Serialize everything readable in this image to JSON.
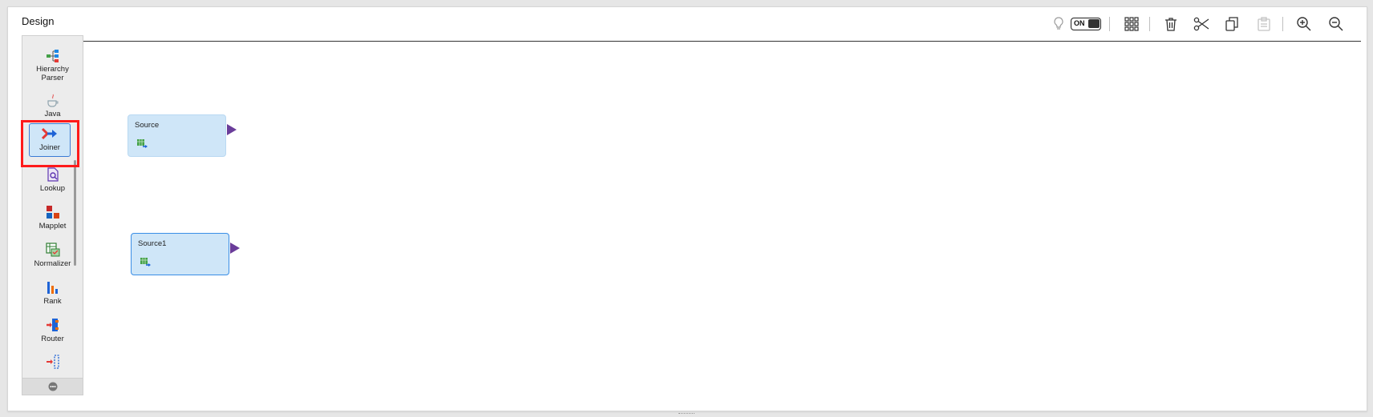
{
  "header": {
    "title": "Design",
    "toggle_label": "ON"
  },
  "toolbar_icons": [
    "lightbulb-icon",
    "auto-layout-toggle",
    "grid-icon",
    "delete-icon",
    "cut-icon",
    "copy-icon",
    "paste-icon",
    "zoom-in-icon",
    "zoom-out-icon"
  ],
  "palette": {
    "items": [
      {
        "label": "Hierarchy Parser",
        "icon": "hierarchy-parser-icon"
      },
      {
        "label": "Java",
        "icon": "java-icon"
      },
      {
        "label": "Joiner",
        "icon": "joiner-icon",
        "selected": true
      },
      {
        "label": "Lookup",
        "icon": "lookup-icon"
      },
      {
        "label": "Mapplet",
        "icon": "mapplet-icon"
      },
      {
        "label": "Normalizer",
        "icon": "normalizer-icon"
      },
      {
        "label": "Rank",
        "icon": "rank-icon"
      },
      {
        "label": "Router",
        "icon": "router-icon"
      },
      {
        "label": "",
        "icon": "sequence-icon"
      }
    ],
    "more_icon": "more-icon"
  },
  "canvas": {
    "nodes": [
      {
        "label": "Source",
        "icon": "source-table-icon"
      },
      {
        "label": "Source1",
        "icon": "source-table-icon"
      }
    ]
  },
  "colors": {
    "node_fill": "#cfe6f8",
    "port": "#6a3d9a",
    "highlight": "#ff1a1a",
    "selected_border": "#3a8ee6"
  }
}
